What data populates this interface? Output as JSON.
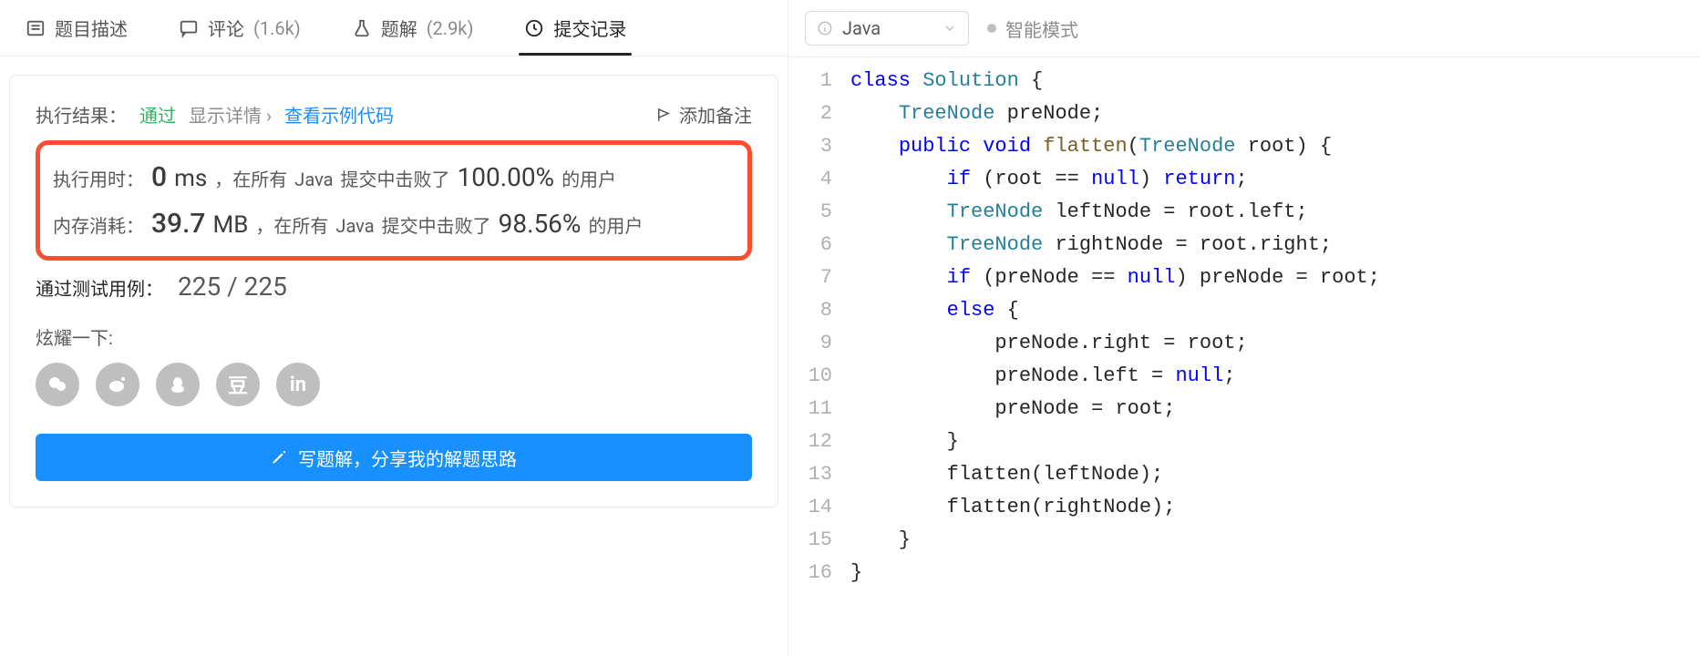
{
  "tabs": {
    "description": {
      "label": "题目描述"
    },
    "comments": {
      "label": "评论",
      "count": "(1.6k)"
    },
    "solutions": {
      "label": "题解",
      "count": "(2.9k)"
    },
    "submissions": {
      "label": "提交记录"
    }
  },
  "result": {
    "execResultLabel": "执行结果：",
    "status": "通过",
    "showDetail": "显示详情",
    "showDetailArrow": "›",
    "viewSample": "查看示例代码",
    "addNote": "添加备注",
    "runtime": {
      "label": "执行用时：",
      "value": "0",
      "unit": "ms",
      "narr1": "，在所有",
      "lang": "Java",
      "narr2": "提交中击败了",
      "percent": "100.00%",
      "narr3": "的用户"
    },
    "memory": {
      "label": "内存消耗：",
      "value": "39.7",
      "unit": "MB",
      "narr1": "，在所有",
      "lang": "Java",
      "narr2": "提交中击败了",
      "percent": "98.56%",
      "narr3": "的用户"
    },
    "tests": {
      "label": "通过测试用例：",
      "value": "225 / 225"
    },
    "shareLabel": "炫耀一下:",
    "shareIcons": {
      "wechat": "wechat-icon",
      "weibo": "weibo-icon",
      "qq": "qq-icon",
      "douban": "豆",
      "linkedin": "in"
    },
    "cta": "写题解，分享我的解题思路"
  },
  "editorHeader": {
    "language": "Java",
    "mode": "智能模式"
  },
  "code": {
    "lines": [
      {
        "n": 1,
        "tokens": [
          {
            "t": "class ",
            "c": "kw"
          },
          {
            "t": "Solution",
            "c": "cls"
          },
          {
            "t": " {",
            "c": ""
          }
        ]
      },
      {
        "n": 2,
        "tokens": [
          {
            "t": "    ",
            "c": ""
          },
          {
            "t": "TreeNode",
            "c": "type"
          },
          {
            "t": " preNode;",
            "c": ""
          }
        ]
      },
      {
        "n": 3,
        "tokens": [
          {
            "t": "    ",
            "c": ""
          },
          {
            "t": "public ",
            "c": "kw"
          },
          {
            "t": "void ",
            "c": "kw"
          },
          {
            "t": "flatten",
            "c": "method"
          },
          {
            "t": "(",
            "c": ""
          },
          {
            "t": "TreeNode",
            "c": "type"
          },
          {
            "t": " root) {",
            "c": ""
          }
        ]
      },
      {
        "n": 4,
        "tokens": [
          {
            "t": "        ",
            "c": ""
          },
          {
            "t": "if ",
            "c": "kw"
          },
          {
            "t": "(root == ",
            "c": ""
          },
          {
            "t": "null",
            "c": "null"
          },
          {
            "t": ") ",
            "c": ""
          },
          {
            "t": "return",
            "c": "kw"
          },
          {
            "t": ";",
            "c": ""
          }
        ]
      },
      {
        "n": 5,
        "tokens": [
          {
            "t": "        ",
            "c": ""
          },
          {
            "t": "TreeNode",
            "c": "type"
          },
          {
            "t": " leftNode = root.left;",
            "c": ""
          }
        ]
      },
      {
        "n": 6,
        "tokens": [
          {
            "t": "        ",
            "c": ""
          },
          {
            "t": "TreeNode",
            "c": "type"
          },
          {
            "t": " rightNode = root.right;",
            "c": ""
          }
        ]
      },
      {
        "n": 7,
        "tokens": [
          {
            "t": "        ",
            "c": ""
          },
          {
            "t": "if ",
            "c": "kw"
          },
          {
            "t": "(preNode == ",
            "c": ""
          },
          {
            "t": "null",
            "c": "null"
          },
          {
            "t": ") preNode = root;",
            "c": ""
          }
        ]
      },
      {
        "n": 8,
        "tokens": [
          {
            "t": "        ",
            "c": ""
          },
          {
            "t": "else ",
            "c": "kw"
          },
          {
            "t": "{",
            "c": ""
          }
        ]
      },
      {
        "n": 9,
        "tokens": [
          {
            "t": "            preNode.right = root;",
            "c": ""
          }
        ]
      },
      {
        "n": 10,
        "tokens": [
          {
            "t": "            preNode.left = ",
            "c": ""
          },
          {
            "t": "null",
            "c": "null"
          },
          {
            "t": ";",
            "c": ""
          }
        ]
      },
      {
        "n": 11,
        "tokens": [
          {
            "t": "            preNode = root;",
            "c": ""
          }
        ]
      },
      {
        "n": 12,
        "tokens": [
          {
            "t": "        }",
            "c": ""
          }
        ]
      },
      {
        "n": 13,
        "tokens": [
          {
            "t": "        flatten(leftNode);",
            "c": ""
          }
        ]
      },
      {
        "n": 14,
        "tokens": [
          {
            "t": "        flatten(rightNode);",
            "c": ""
          }
        ]
      },
      {
        "n": 15,
        "tokens": [
          {
            "t": "    }",
            "c": ""
          }
        ]
      },
      {
        "n": 16,
        "tokens": [
          {
            "t": "}",
            "c": ""
          }
        ]
      }
    ]
  }
}
